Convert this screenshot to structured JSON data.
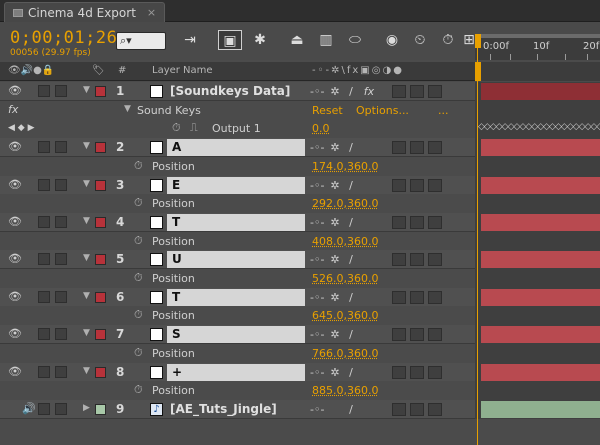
{
  "tab": {
    "title": "Cinema 4d Export",
    "close": "×"
  },
  "toolbar": {
    "timecode": "0;00;01;26",
    "frames": "00056 (29.97 fps)",
    "search_placeholder": "⌕▾"
  },
  "ruler": {
    "labels": [
      "0:00f",
      "10f",
      "20f"
    ]
  },
  "header": {
    "layer_name": "Layer Name",
    "num": "#"
  },
  "layers": [
    {
      "num": "1",
      "name": "[Soundkeys Data]",
      "color": "#b8323a",
      "kind": "solid"
    },
    {
      "num": "2",
      "name": "A",
      "color": "#b8323a",
      "kind": "text",
      "position": "174.0,360.0"
    },
    {
      "num": "3",
      "name": "E",
      "color": "#b8323a",
      "kind": "text",
      "position": "292.0,360.0"
    },
    {
      "num": "4",
      "name": "T",
      "color": "#b8323a",
      "kind": "text",
      "position": "408.0,360.0"
    },
    {
      "num": "5",
      "name": "U",
      "color": "#b8323a",
      "kind": "text",
      "position": "526.0,360.0"
    },
    {
      "num": "6",
      "name": "T",
      "color": "#b8323a",
      "kind": "text",
      "position": "645.0,360.0"
    },
    {
      "num": "7",
      "name": "S",
      "color": "#b8323a",
      "kind": "text",
      "position": "766.0,360.0"
    },
    {
      "num": "8",
      "name": "+",
      "color": "#b8323a",
      "kind": "text",
      "position": "885.0,360.0"
    },
    {
      "num": "9",
      "name": "[AE_Tuts_Jingle]",
      "color": "#a8c8a8",
      "kind": "audio"
    }
  ],
  "effect": {
    "name": "Sound Keys",
    "reset": "Reset",
    "options": "Options...",
    "dots": "...",
    "output_label": "Output 1",
    "output_value": "0.0"
  },
  "property_label": "Position",
  "colors": {
    "accent": "#e8a000",
    "track_red": "#b84a50",
    "track_green": "#8fb08f"
  }
}
